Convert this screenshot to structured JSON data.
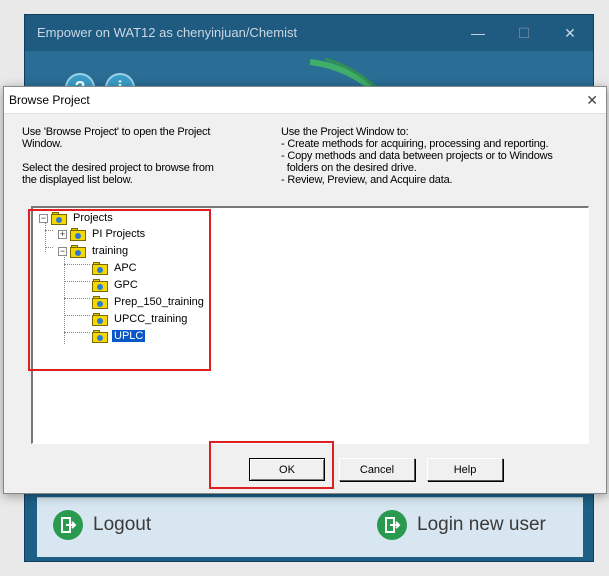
{
  "background_window": {
    "title": "Empower on WAT12 as chenyinjuan/Chemist",
    "minimize_glyph": "—",
    "maximize_glyph": "☐",
    "close_glyph": "✕",
    "help_icon_glyph": "?",
    "info_icon_glyph": "i",
    "logout_label": "Logout",
    "login_new_user_label": "Login new user"
  },
  "dialog": {
    "title": "Browse Project",
    "close_glyph": "✕",
    "instructions_left": [
      "Use 'Browse Project' to open the Project",
      "Window.",
      "",
      "Select the desired project to browse from",
      "the displayed list below."
    ],
    "instructions_right": [
      "Use the Project Window to:",
      "- Create methods for acquiring, processing and reporting.",
      "- Copy methods and data between projects or to Windows",
      "  folders on the desired drive.",
      "- Review, Preview, and Acquire data."
    ],
    "tree": {
      "root": {
        "label": "Projects",
        "expander": "−"
      },
      "pi_projects": {
        "label": "PI Projects",
        "expander": "+"
      },
      "training": {
        "label": "training",
        "expander": "−"
      },
      "children": [
        {
          "label": "APC"
        },
        {
          "label": "GPC"
        },
        {
          "label": "Prep_150_training"
        },
        {
          "label": "UPCC_training"
        },
        {
          "label": "UPLC"
        }
      ],
      "selected": "UPLC"
    },
    "buttons": {
      "ok": "OK",
      "cancel": "Cancel",
      "help": "Help"
    }
  },
  "colors": {
    "highlight_box": "#e02020",
    "selection": "#0a58c8",
    "empower_blue": "#1e5f86"
  }
}
